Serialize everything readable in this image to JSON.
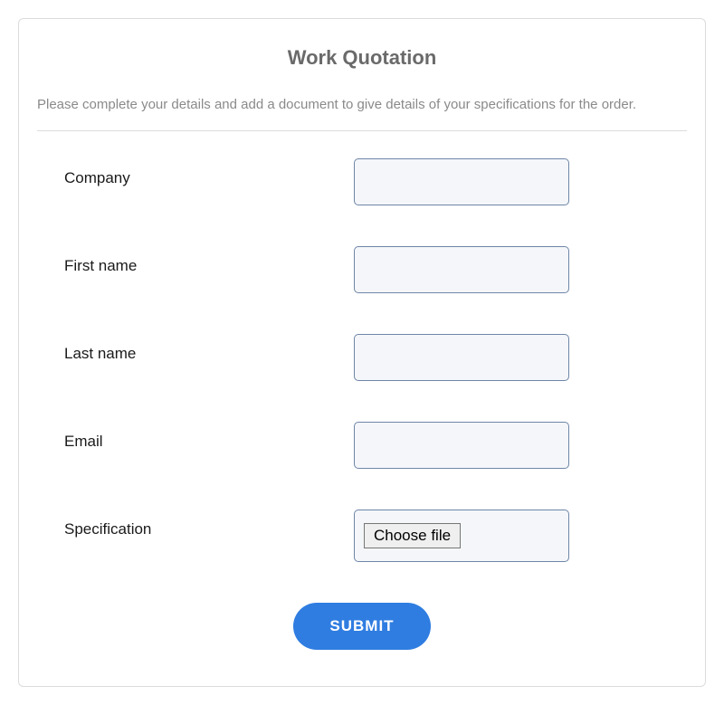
{
  "title": "Work Quotation",
  "instructions": "Please complete your details and add a document to give details of your specifications for the order.",
  "fields": {
    "company": {
      "label": "Company",
      "value": ""
    },
    "first_name": {
      "label": "First name",
      "value": ""
    },
    "last_name": {
      "label": "Last name",
      "value": ""
    },
    "email": {
      "label": "Email",
      "value": ""
    },
    "specification": {
      "label": "Specification",
      "button_label": "Choose file"
    }
  },
  "submit_label": "SUBMIT"
}
